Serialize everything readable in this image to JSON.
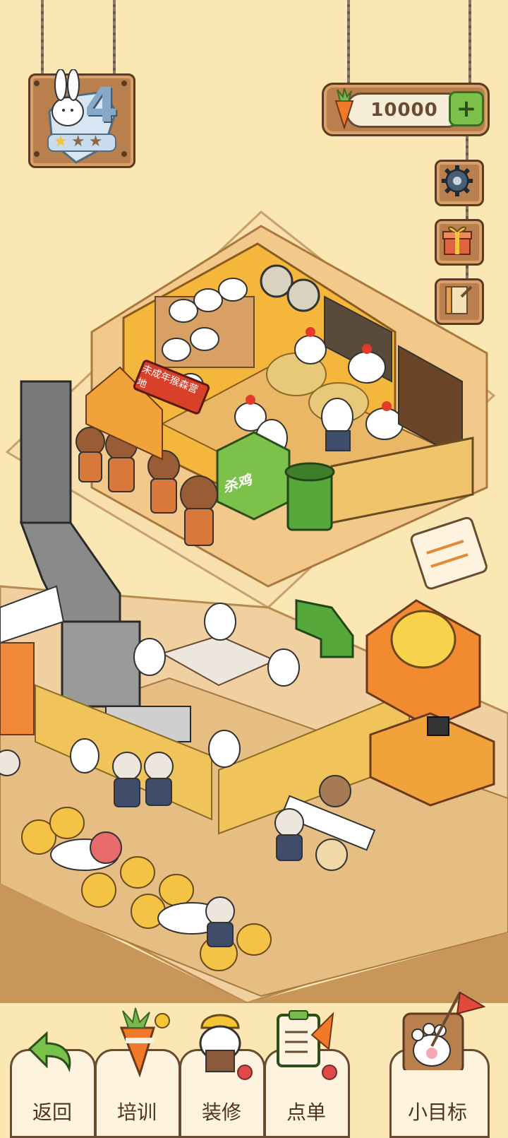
{
  "hud": {
    "level": "4",
    "stars_filled": 1,
    "stars_total": 3,
    "currency_amount": "10000",
    "currency_icon": "carrot-icon",
    "add_icon": "plus-icon"
  },
  "side_buttons": [
    {
      "name": "settings-button",
      "icon": "gear-icon"
    },
    {
      "name": "gift-button",
      "icon": "gift-icon"
    },
    {
      "name": "notes-button",
      "icon": "notebook-icon"
    }
  ],
  "scene": {
    "upper_sign": "未成年猴森营地",
    "green_counter_label": "杀鸡"
  },
  "nav": {
    "back": "返回",
    "train": "培训",
    "decorate": "装修",
    "order": "点单",
    "goal": "小目标"
  },
  "colors": {
    "background": "#fbe7b4",
    "wood": "#b9804e",
    "dark_outline": "#5b3b23",
    "green": "#7cc24a",
    "red_dot": "#e14a4a"
  }
}
